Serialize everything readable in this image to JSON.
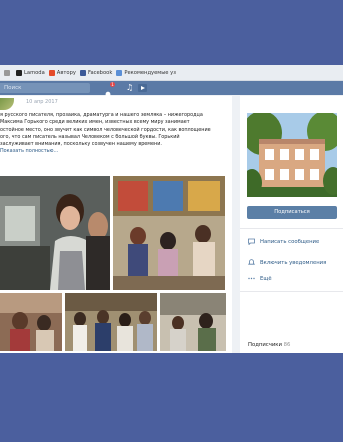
{
  "bookmarks": [
    {
      "label": "",
      "color": "#888888"
    },
    {
      "label": "Lamoda",
      "color": "#222222"
    },
    {
      "label": "Автору",
      "color": "#e44b2a"
    },
    {
      "label": "Facebook",
      "color": "#3b5998"
    },
    {
      "label": "Рекомендуемые уз",
      "color": "#5b8fd6"
    }
  ],
  "topbar": {
    "search_placeholder": "Поиск",
    "notifications_count": "1"
  },
  "post": {
    "date": "10 апр 2017",
    "text_lines": [
      "я русского писателя, прозаика, драматурга и нашего земляка – нижегородца",
      "Максима Горького среди великих имен, известных всему миру занимает",
      "остойное место, оно звучит как символ человеческой гордости, как воплощение",
      "ого, что сам писатель называл Человеком с большой буквы. Горький",
      "заслуживает внимания, поскольку созвучен нашему времени."
    ],
    "show_more": "Показать полностью..."
  },
  "sidebar": {
    "subscribe_label": "Подписаться",
    "actions": [
      {
        "label": "Написать сообщение",
        "icon": "message-icon"
      },
      {
        "label": "Включить уведомления",
        "icon": "bell-icon"
      },
      {
        "label": "Ещё",
        "icon": "more-icon"
      }
    ],
    "followers_label": "Подписчики",
    "followers_count": "86"
  },
  "colors": {
    "background": "#4b5f9e",
    "vk_header": "#5b7aa6",
    "button": "#5b7fa6",
    "link": "#2a5885"
  }
}
